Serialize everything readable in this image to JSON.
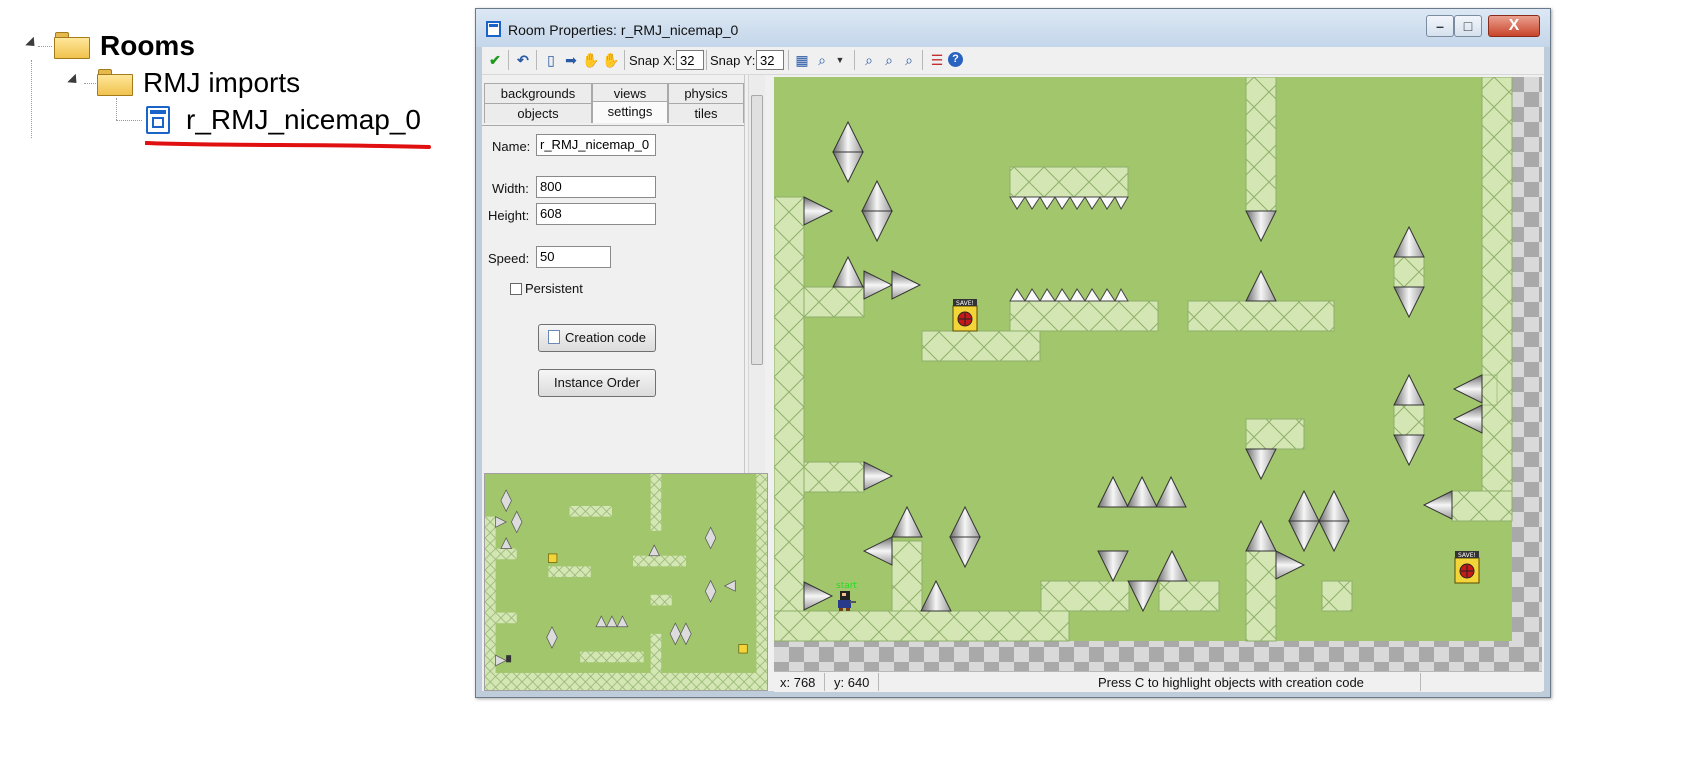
{
  "tree": {
    "root_label": "Rooms",
    "group_label": "RMJ imports",
    "item_label": "r_RMJ_nicemap_0"
  },
  "window": {
    "title": "Room Properties: r_RMJ_nicemap_0",
    "controls": {
      "minimize": "–",
      "maximize": "□",
      "close": "X"
    }
  },
  "toolbar": {
    "snap_x_label": "Snap X:",
    "snap_x_value": "32",
    "snap_y_label": "Snap Y:",
    "snap_y_value": "32",
    "icons": [
      "ok-check-icon",
      "undo-icon",
      "new-doc-icon",
      "shift-arrow-icon",
      "hand-icon",
      "hand-alt-icon",
      "grid-icon",
      "zoom-icon",
      "dropdown-icon",
      "zoom-in-icon",
      "zoom-out-icon",
      "zoom-reset-icon",
      "list-icon",
      "help-icon"
    ]
  },
  "tabs": {
    "row1": [
      "backgrounds",
      "views",
      "physics"
    ],
    "row2": [
      "objects",
      "settings",
      "tiles"
    ],
    "active": "settings"
  },
  "settings": {
    "name_label": "Name:",
    "name_value": "r_RMJ_nicemap_0",
    "width_label": "Width:",
    "width_value": "800",
    "height_label": "Height:",
    "height_value": "608",
    "speed_label": "Speed:",
    "speed_value": "50",
    "persistent_label": "Persistent",
    "persistent_checked": false,
    "creation_code_label": "Creation code",
    "instance_order_label": "Instance Order"
  },
  "room": {
    "save_label": "SAVE!",
    "start_label": "start",
    "colors": {
      "floor": "#a2c66c",
      "block": "#d3e6b4",
      "block_line": "#8fb06a",
      "spike_dark": "#555555",
      "spike_light": "#f4f4f4"
    }
  },
  "status": {
    "x": "x: 768",
    "y": "y: 640",
    "hint": "Press C to highlight objects with creation code"
  }
}
